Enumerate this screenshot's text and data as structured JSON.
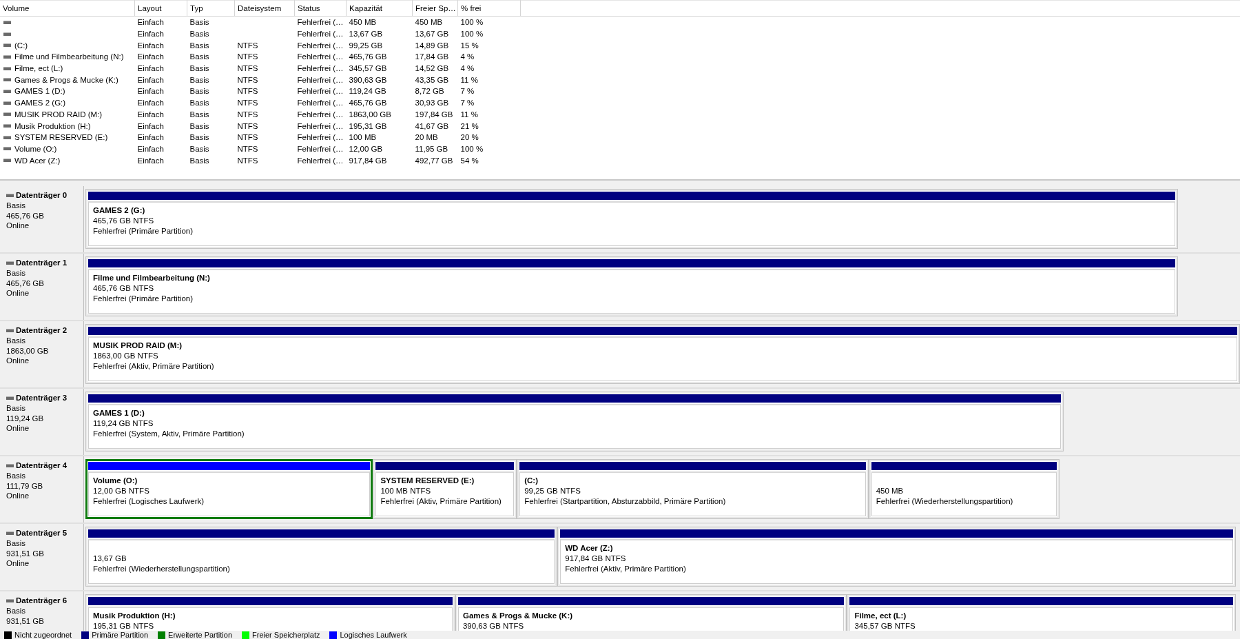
{
  "volume_table": {
    "columns": [
      "Volume",
      "Layout",
      "Typ",
      "Dateisystem",
      "Status",
      "Kapazität",
      "Freier Sp…",
      "% frei"
    ],
    "rows": [
      {
        "layout": "Einfach",
        "type": "Basis",
        "status": "Fehlerfrei (…",
        "capacity": "450 MB",
        "free": "450 MB",
        "percent_free": "100 %"
      },
      {
        "layout": "Einfach",
        "type": "Basis",
        "status": "Fehlerfrei (…",
        "capacity": "13,67 GB",
        "free": "13,67 GB",
        "percent_free": "100 %"
      },
      {
        "volume": "(C:)",
        "layout": "Einfach",
        "type": "Basis",
        "file_system": "NTFS",
        "status": "Fehlerfrei (…",
        "capacity": "99,25 GB",
        "free": "14,89 GB",
        "percent_free": "15 %"
      },
      {
        "volume": "Filme und Filmbearbeitung (N:)",
        "layout": "Einfach",
        "type": "Basis",
        "file_system": "NTFS",
        "status": "Fehlerfrei (…",
        "capacity": "465,76 GB",
        "free": "17,84 GB",
        "percent_free": "4 %"
      },
      {
        "volume": "Filme, ect (L:)",
        "layout": "Einfach",
        "type": "Basis",
        "file_system": "NTFS",
        "status": "Fehlerfrei (…",
        "capacity": "345,57 GB",
        "free": "14,52 GB",
        "percent_free": "4 %"
      },
      {
        "volume": "Games & Progs & Mucke (K:)",
        "layout": "Einfach",
        "type": "Basis",
        "file_system": "NTFS",
        "status": "Fehlerfrei (…",
        "capacity": "390,63 GB",
        "free": "43,35 GB",
        "percent_free": "11 %"
      },
      {
        "volume": "GAMES 1 (D:)",
        "layout": "Einfach",
        "type": "Basis",
        "file_system": "NTFS",
        "status": "Fehlerfrei (…",
        "capacity": "119,24 GB",
        "free": "8,72 GB",
        "percent_free": "7 %"
      },
      {
        "volume": "GAMES 2 (G:)",
        "layout": "Einfach",
        "type": "Basis",
        "file_system": "NTFS",
        "status": "Fehlerfrei (…",
        "capacity": "465,76 GB",
        "free": "30,93 GB",
        "percent_free": "7 %"
      },
      {
        "volume": "MUSIK PROD RAID (M:)",
        "layout": "Einfach",
        "type": "Basis",
        "file_system": "NTFS",
        "status": "Fehlerfrei (…",
        "capacity": "1863,00 GB",
        "free": "197,84 GB",
        "percent_free": "11 %"
      },
      {
        "volume": "Musik Produktion (H:)",
        "layout": "Einfach",
        "type": "Basis",
        "file_system": "NTFS",
        "status": "Fehlerfrei (…",
        "capacity": "195,31 GB",
        "free": "41,67 GB",
        "percent_free": "21 %"
      },
      {
        "volume": "SYSTEM RESERVED (E:)",
        "layout": "Einfach",
        "type": "Basis",
        "file_system": "NTFS",
        "status": "Fehlerfrei (…",
        "capacity": "100 MB",
        "free": "20 MB",
        "percent_free": "20 %"
      },
      {
        "volume": "Volume (O:)",
        "layout": "Einfach",
        "type": "Basis",
        "file_system": "NTFS",
        "status": "Fehlerfrei (…",
        "capacity": "12,00 GB",
        "free": "11,95 GB",
        "percent_free": "100 %"
      },
      {
        "volume": "WD Acer (Z:)",
        "layout": "Einfach",
        "type": "Basis",
        "file_system": "NTFS",
        "status": "Fehlerfrei (…",
        "capacity": "917,84 GB",
        "free": "492,77 GB",
        "percent_free": "54 %"
      }
    ]
  },
  "disks": [
    {
      "name": "Datenträger 0",
      "type": "Basis",
      "size": "465,76 GB",
      "state": "Online",
      "partitions": [
        {
          "kind": "primary",
          "title": "GAMES 2  (G:)",
          "size": "465,76 GB NTFS",
          "status": "Fehlerfrei (Primäre Partition)"
        }
      ]
    },
    {
      "name": "Datenträger 1",
      "type": "Basis",
      "size": "465,76 GB",
      "state": "Online",
      "partitions": [
        {
          "kind": "primary",
          "title": "Filme und Filmbearbeitung  (N:)",
          "size": "465,76 GB NTFS",
          "status": "Fehlerfrei (Primäre Partition)"
        }
      ]
    },
    {
      "name": "Datenträger 2",
      "type": "Basis",
      "size": "1863,00 GB",
      "state": "Online",
      "partitions": [
        {
          "kind": "primary",
          "title": "MUSIK PROD RAID  (M:)",
          "size": "1863,00 GB NTFS",
          "status": "Fehlerfrei (Aktiv, Primäre Partition)"
        }
      ]
    },
    {
      "name": "Datenträger 3",
      "type": "Basis",
      "size": "119,24 GB",
      "state": "Online",
      "partitions": [
        {
          "kind": "primary",
          "title": "GAMES 1  (D:)",
          "size": "119,24 GB NTFS",
          "status": "Fehlerfrei (System, Aktiv, Primäre Partition)"
        }
      ]
    },
    {
      "name": "Datenträger 4",
      "type": "Basis",
      "size": "111,79 GB",
      "state": "Online",
      "partitions": [
        {
          "kind": "logical",
          "title": "Volume  (O:)",
          "size": "12,00 GB NTFS",
          "status": "Fehlerfrei (Logisches Laufwerk)"
        },
        {
          "kind": "primary",
          "title": "SYSTEM RESERVED  (E:)",
          "size": "100 MB NTFS",
          "status": "Fehlerfrei (Aktiv, Primäre Partition)"
        },
        {
          "kind": "primary",
          "title": "(C:)",
          "size": "99,25 GB NTFS",
          "status": "Fehlerfrei (Startpartition, Absturzabbild, Primäre Partition)"
        },
        {
          "kind": "primary",
          "size": "450 MB",
          "status": "Fehlerfrei (Wiederherstellungspartition)"
        }
      ]
    },
    {
      "name": "Datenträger 5",
      "type": "Basis",
      "size": "931,51 GB",
      "state": "Online",
      "partitions": [
        {
          "kind": "primary",
          "size": "13,67 GB",
          "status": "Fehlerfrei (Wiederherstellungspartition)"
        },
        {
          "kind": "primary",
          "title": "WD Acer  (Z:)",
          "size": "917,84 GB NTFS",
          "status": "Fehlerfrei (Aktiv, Primäre Partition)"
        }
      ]
    },
    {
      "name": "Datenträger 6",
      "type": "Basis",
      "size": "931,51 GB",
      "partitions": [
        {
          "kind": "primary",
          "title": "Musik Produktion  (H:)",
          "size": "195,31 GB NTFS"
        },
        {
          "kind": "primary",
          "title": "Games & Progs & Mucke  (K:)",
          "size": "390,63 GB NTFS"
        },
        {
          "kind": "primary",
          "title": "Filme, ect  (L:)",
          "size": "345,57 GB NTFS"
        }
      ]
    }
  ],
  "legend": [
    {
      "label": "Nicht zugeordnet",
      "color": "#000000"
    },
    {
      "label": "Primäre Partition",
      "color": "#000080"
    },
    {
      "label": "Erweiterte Partition",
      "color": "#008000"
    },
    {
      "label": "Freier Speicherplatz",
      "color": "#00ff00"
    },
    {
      "label": "Logisches Laufwerk",
      "color": "#0000ff"
    }
  ]
}
